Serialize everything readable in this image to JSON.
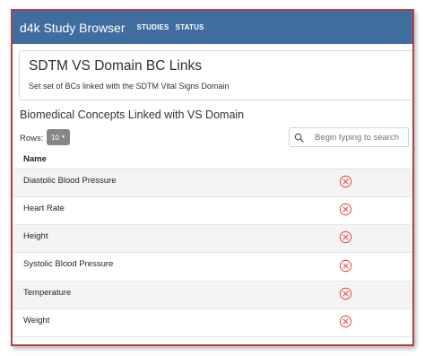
{
  "navbar": {
    "brand": "d4k Study Browser",
    "links": [
      "STUDIES",
      "STATUS"
    ]
  },
  "card": {
    "title": "SDTM VS Domain BC Links",
    "text": "Set set of BCs linked with the SDTM Vital Signs Domain"
  },
  "section": {
    "heading": "Biomedical Concepts Linked with VS Domain"
  },
  "table_controls": {
    "rows_label": "Rows:",
    "rows_value": "10",
    "search_placeholder": "Begin typing to search"
  },
  "table": {
    "columns": [
      "Name",
      ""
    ],
    "rows": [
      {
        "name": "Diastolic Blood Pressure"
      },
      {
        "name": "Heart Rate"
      },
      {
        "name": "Height"
      },
      {
        "name": "Systolic Blood Pressure"
      },
      {
        "name": "Temperature"
      },
      {
        "name": "Weight"
      }
    ]
  },
  "icons": {
    "search": "search-icon",
    "remove": "remove-circle-icon",
    "rows_caret": "caret-down-icon"
  },
  "colors": {
    "navbar_bg": "#3f6e9e",
    "frame_border": "#b3404a",
    "remove_icon": "#d9534f",
    "rows_select_bg": "#868686"
  }
}
